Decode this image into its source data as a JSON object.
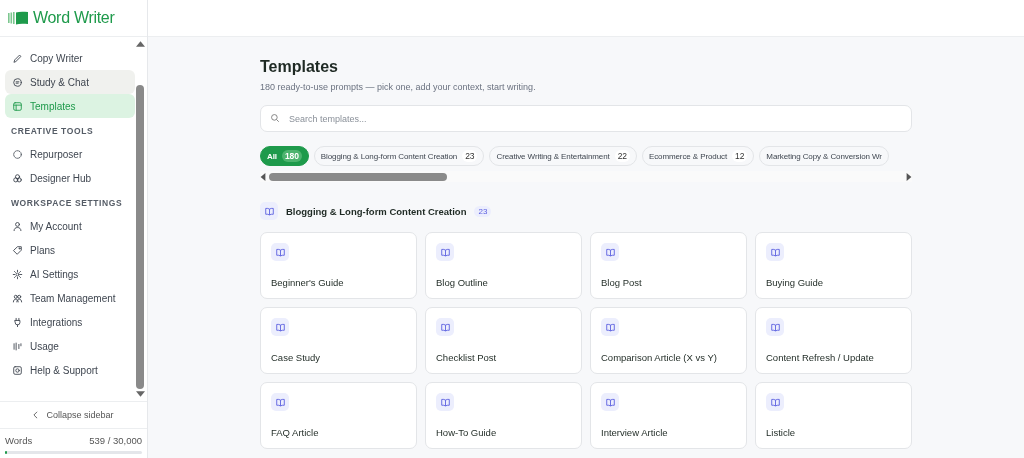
{
  "brand": {
    "name": "Word Writer"
  },
  "sidebar": {
    "groups": [
      {
        "items": [
          {
            "label": "Copy Writer",
            "kind": "pencil",
            "selected": false,
            "hovered": false
          },
          {
            "label": "Study & Chat",
            "kind": "chat",
            "selected": false,
            "hovered": true
          },
          {
            "label": "Templates",
            "kind": "layout",
            "selected": true,
            "hovered": false
          }
        ]
      },
      {
        "heading": "CREATIVE TOOLS",
        "items": [
          {
            "label": "Repurposer",
            "kind": "cycle",
            "selected": false,
            "hovered": false
          },
          {
            "label": "Designer Hub",
            "kind": "circles",
            "selected": false,
            "hovered": false
          }
        ]
      },
      {
        "heading": "WORKSPACE SETTINGS",
        "items": [
          {
            "label": "My Account",
            "kind": "user",
            "selected": false,
            "hovered": false
          },
          {
            "label": "Plans",
            "kind": "tag",
            "selected": false,
            "hovered": false
          },
          {
            "label": "AI Settings",
            "kind": "gear",
            "selected": false,
            "hovered": false
          },
          {
            "label": "Team Management",
            "kind": "team",
            "selected": false,
            "hovered": false
          },
          {
            "label": "Integrations",
            "kind": "plug",
            "selected": false,
            "hovered": false
          },
          {
            "label": "Usage",
            "kind": "usage",
            "selected": false,
            "hovered": false
          },
          {
            "label": "Help & Support",
            "kind": "help",
            "selected": false,
            "hovered": false
          }
        ]
      }
    ],
    "collapse": "Collapse sidebar",
    "words": {
      "label": "Words",
      "reading": "539 / 30,000",
      "level": 0.018
    }
  },
  "page": {
    "title": "Templates",
    "subtitle": "180 ready-to-use prompts — pick one, add your context, start writing.",
    "search": {
      "placeholder": "Search templates..."
    },
    "filters": [
      {
        "label": "All",
        "count": "180",
        "selected": true
      },
      {
        "label": "Blogging & Long-form Content Creation",
        "count": "23",
        "selected": false
      },
      {
        "label": "Creative Writing & Entertainment",
        "count": "22",
        "selected": false
      },
      {
        "label": "Ecommerce & Product",
        "count": "12",
        "selected": false
      },
      {
        "label": "Marketing Copy & Conversion Wr",
        "selected": false
      }
    ],
    "section": {
      "title": "Blogging & Long-form Content Creation",
      "count": "23"
    },
    "cards": [
      "Beginner's Guide",
      "Blog Outline",
      "Blog Post",
      "Buying Guide",
      "Case Study",
      "Checklist Post",
      "Comparison Article (X vs Y)",
      "Content Refresh / Update",
      "FAQ Article",
      "How-To Guide",
      "Interview Article",
      "Listicle"
    ]
  }
}
